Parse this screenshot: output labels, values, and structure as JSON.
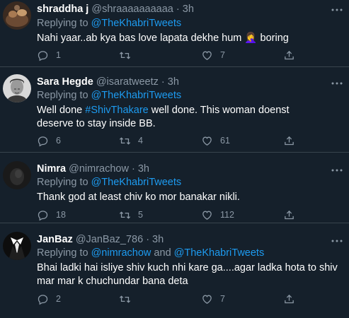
{
  "tweets": [
    {
      "name": "shraddha j",
      "handle": "@shraaaaaaaaaa",
      "time": "· 3h",
      "replying_prefix": "Replying to ",
      "replying_to": "@TheKhabriTweets",
      "text": "Nahi yaar..ab kya bas love lapata dekhe hum",
      "text_emoji": "🤦‍♀️",
      "text_suffix": " boring",
      "replies": "1",
      "retweets": "",
      "likes": "7"
    },
    {
      "name": "Sara Hegde",
      "handle": "@isaratweetz",
      "time": "· 3h",
      "replying_prefix": "Replying to ",
      "replying_to": "@TheKhabriTweets",
      "text_prefix": "Well done ",
      "hashtag": "#ShivThakare",
      "text": " well done. This woman doenst deserve to stay inside BB.",
      "replies": "6",
      "retweets": "4",
      "likes": "61"
    },
    {
      "name": "Nimra",
      "handle": "@nimrachow",
      "time": "· 3h",
      "replying_prefix": "Replying to ",
      "replying_to": "@TheKhabriTweets",
      "text": "Thank god at least chiv ko mor banakar nikli.",
      "replies": "18",
      "retweets": "5",
      "likes": "112"
    },
    {
      "name": "JanBaz",
      "handle": "@JanBaz_786",
      "time": "· 3h",
      "replying_prefix": "Replying to ",
      "replying_to": "@nimrachow",
      "replying_and": " and ",
      "replying_to_2": "@TheKhabriTweets",
      "text": "Bhai ladki hai isliye shiv kuch nhi kare ga....agar ladka hota to shiv mar mar k chuchundar bana deta",
      "replies": "2",
      "retweets": "",
      "likes": "7"
    }
  ],
  "icons": {
    "reply": "reply-icon",
    "retweet": "retweet-icon",
    "like": "heart-icon",
    "share": "share-icon",
    "more": "more-icon"
  },
  "colors": {
    "background": "#15202b",
    "secondary_text": "#8b98a5",
    "link": "#1d9bf0",
    "divider": "#38444d"
  }
}
